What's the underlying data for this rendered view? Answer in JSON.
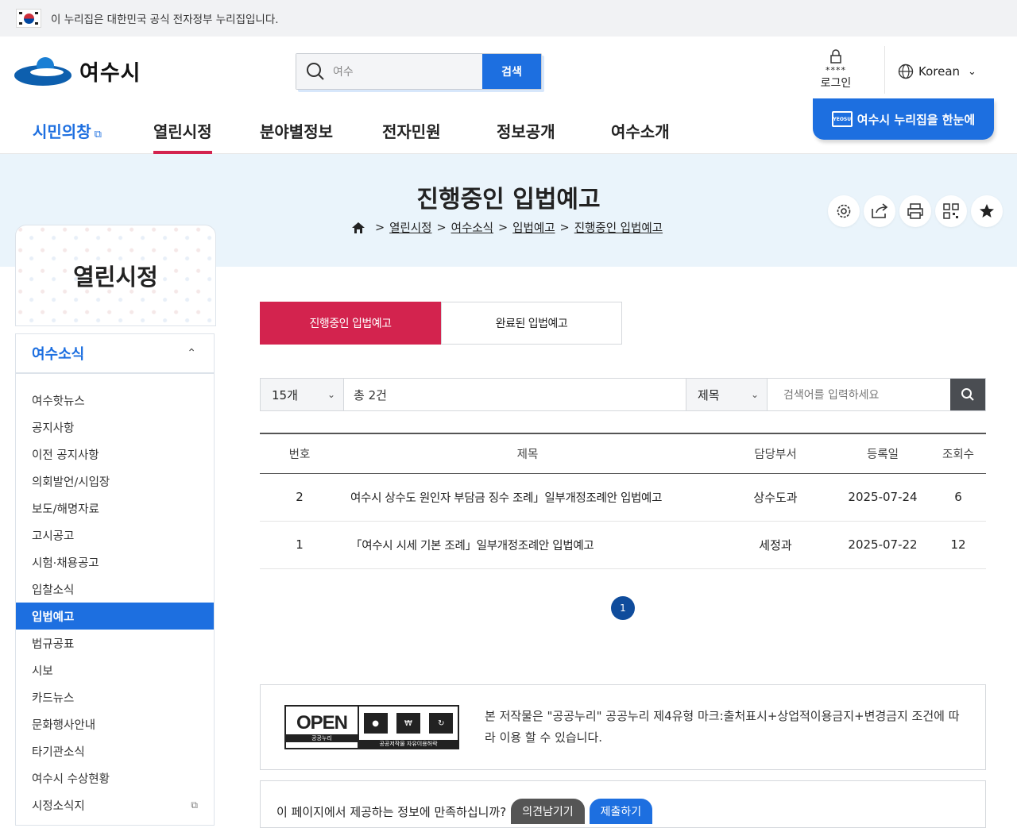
{
  "gov_banner": {
    "text": "이 누리집은 대한민국 공식 전자정부 누리집입니다."
  },
  "header": {
    "logo_text": "여수시",
    "search": {
      "value": "여수",
      "button": "검색"
    },
    "login": {
      "stars": "****",
      "label": "로그인"
    },
    "language": "Korean"
  },
  "gnb": {
    "items": [
      "시민의창",
      "열린시정",
      "분야별정보",
      "전자민원",
      "정보공개",
      "여수소개"
    ],
    "active": "열린시정",
    "overview_button": "여수시 누리집을 한눈에",
    "overview_icon_text": "YEOSU"
  },
  "page": {
    "title": "진행중인 입법예고",
    "breadcrumb": [
      "열린시정",
      "여수소식",
      "입법예고",
      "진행중인 입법예고"
    ]
  },
  "sidebar": {
    "title": "열린시정",
    "group": "여수소식",
    "items": [
      "여수핫뉴스",
      "공지사항",
      "이전 공지사항",
      "의회발언/시입장",
      "보도/해명자료",
      "고시공고",
      "시험·채용공고",
      "입찰소식",
      "입법예고",
      "법규공표",
      "시보",
      "카드뉴스",
      "문화행사안내",
      "타기관소식",
      "여수시 수상현황",
      "시정소식지"
    ],
    "active": "입법예고"
  },
  "tabs": [
    "진행중인 입법예고",
    "완료된 입법예고"
  ],
  "filter": {
    "page_size": "15개",
    "total": "총 2건",
    "field": "제목",
    "keyword_placeholder": "검색어를 입력하세요"
  },
  "table": {
    "headers": [
      "번호",
      "제목",
      "담당부서",
      "등록일",
      "조회수"
    ],
    "rows": [
      {
        "no": "2",
        "title": "여수시 상수도 원인자 부담금 징수 조례」일부개정조례안 입법예고",
        "dept": "상수도과",
        "date": "2025-07-24",
        "views": "6"
      },
      {
        "no": "1",
        "title": "「여수시 시세 기본 조례」일부개정조례안 입법예고",
        "dept": "세정과",
        "date": "2025-07-22",
        "views": "12"
      }
    ]
  },
  "pagination": {
    "current": "1"
  },
  "license": {
    "open_label": "OPEN",
    "open_sub": "공공누리",
    "mark_sub": "공공저작물 자유이용허락",
    "text": "본 저작물은 \"공공누리\" 공공누리 제4유형 마크:출처표시+상업적이용금지+변경금지 조건에 따라 이용 할 수 있습니다."
  },
  "survey": {
    "question": "이 페이지에서 제공하는 정보에 만족하십니까?",
    "btn_opinion": "의견남기기",
    "btn_submit": "제출하기"
  },
  "icons": {
    "search": "search-icon",
    "lock": "lock-icon",
    "globe": "globe-icon",
    "home": "home-icon",
    "settings": "gear-icon",
    "share": "share-icon",
    "print": "print-icon",
    "qr": "qr-icon",
    "bookmark": "star-icon"
  },
  "colors": {
    "primary": "#1d6fe0",
    "accent": "#d3234e",
    "hero_bg": "#eaf4fb",
    "pager": "#0f4c9c"
  }
}
